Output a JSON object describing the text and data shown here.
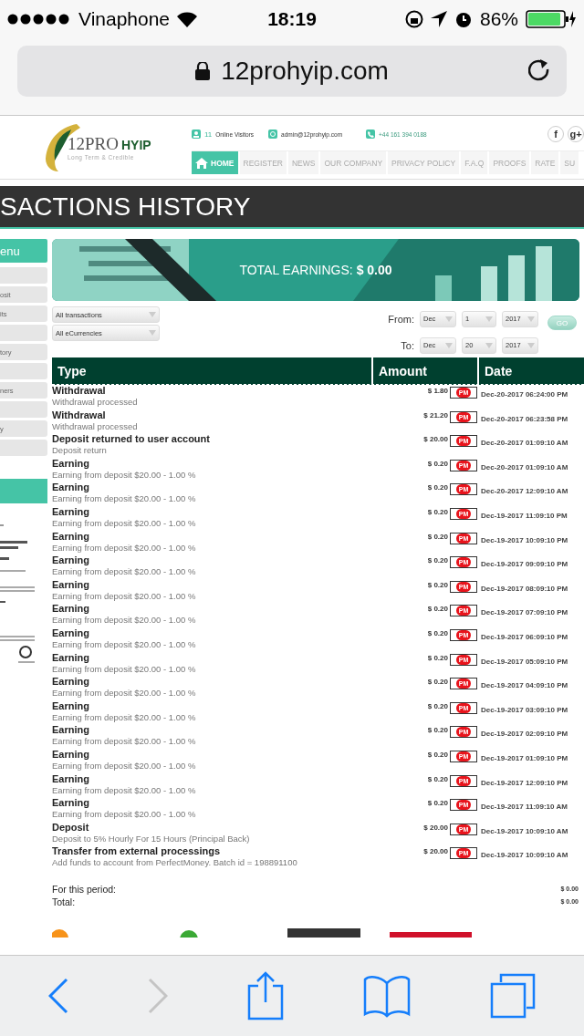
{
  "status_bar": {
    "carrier": "Vinaphone",
    "time": "18:19",
    "battery": "86%"
  },
  "address_bar": {
    "url": "12prohyip.com"
  },
  "header": {
    "logo_main": "12PRO",
    "logo_accent": "HYIP",
    "tagline": "Long Term & Credible",
    "visitors_count": "11",
    "visitors_label": "Online Visitors",
    "email": "admin@12prohyip.com",
    "phone": "+44 161 394 0188",
    "social": [
      "f",
      "g+"
    ]
  },
  "nav": [
    {
      "label": "HOME",
      "selected": true
    },
    {
      "label": "REGISTER",
      "selected": false
    },
    {
      "label": "NEWS",
      "selected": false
    },
    {
      "label": "OUR COMPANY",
      "selected": false
    },
    {
      "label": "PRIVACY POLICY",
      "selected": false
    },
    {
      "label": "F.A.Q",
      "selected": false
    },
    {
      "label": "PROOFS",
      "selected": false
    },
    {
      "label": "RATE",
      "selected": false
    },
    {
      "label": "SU",
      "selected": false
    }
  ],
  "page_title": "SACTIONS HISTORY",
  "sidebar": {
    "title": "enu",
    "items": [
      {
        "kind": "blank"
      },
      {
        "kind": "text",
        "label": "osit"
      },
      {
        "kind": "text",
        "label": "its"
      },
      {
        "kind": "blank"
      },
      {
        "kind": "text",
        "label": "tory"
      },
      {
        "kind": "blank"
      },
      {
        "kind": "text",
        "label": "ners"
      },
      {
        "kind": "blank"
      },
      {
        "kind": "text",
        "label": "y"
      },
      {
        "kind": "blank"
      }
    ]
  },
  "banner": {
    "label": "TOTAL EARNINGS:",
    "value": "$ 0.00"
  },
  "filters": {
    "transaction_type": "All transactions",
    "currency": "All eCurrencies",
    "from": {
      "label": "From:",
      "month": "Dec",
      "day": "1",
      "year": "2017"
    },
    "to": {
      "label": "To:",
      "month": "Dec",
      "day": "20",
      "year": "2017"
    },
    "go": "GO"
  },
  "table": {
    "columns": [
      "Type",
      "Amount",
      "Date"
    ],
    "rows": [
      {
        "type": "Withdrawal",
        "description": "Withdrawal processed",
        "amount": "$ 1.80",
        "processor": "PM",
        "date": "Dec-20-2017 06:24:00 PM"
      },
      {
        "type": "Withdrawal",
        "description": "Withdrawal processed",
        "amount": "$ 21.20",
        "processor": "PM",
        "date": "Dec-20-2017 06:23:58 PM"
      },
      {
        "type": "Deposit returned to user account",
        "description": "Deposit return",
        "amount": "$ 20.00",
        "processor": "PM",
        "date": "Dec-20-2017 01:09:10 AM"
      },
      {
        "type": "Earning",
        "description": "Earning from deposit $20.00 - 1.00 %",
        "amount": "$ 0.20",
        "processor": "PM",
        "date": "Dec-20-2017 01:09:10 AM"
      },
      {
        "type": "Earning",
        "description": "Earning from deposit $20.00 - 1.00 %",
        "amount": "$ 0.20",
        "processor": "PM",
        "date": "Dec-20-2017 12:09:10 AM"
      },
      {
        "type": "Earning",
        "description": "Earning from deposit $20.00 - 1.00 %",
        "amount": "$ 0.20",
        "processor": "PM",
        "date": "Dec-19-2017 11:09:10 PM"
      },
      {
        "type": "Earning",
        "description": "Earning from deposit $20.00 - 1.00 %",
        "amount": "$ 0.20",
        "processor": "PM",
        "date": "Dec-19-2017 10:09:10 PM"
      },
      {
        "type": "Earning",
        "description": "Earning from deposit $20.00 - 1.00 %",
        "amount": "$ 0.20",
        "processor": "PM",
        "date": "Dec-19-2017 09:09:10 PM"
      },
      {
        "type": "Earning",
        "description": "Earning from deposit $20.00 - 1.00 %",
        "amount": "$ 0.20",
        "processor": "PM",
        "date": "Dec-19-2017 08:09:10 PM"
      },
      {
        "type": "Earning",
        "description": "Earning from deposit $20.00 - 1.00 %",
        "amount": "$ 0.20",
        "processor": "PM",
        "date": "Dec-19-2017 07:09:10 PM"
      },
      {
        "type": "Earning",
        "description": "Earning from deposit $20.00 - 1.00 %",
        "amount": "$ 0.20",
        "processor": "PM",
        "date": "Dec-19-2017 06:09:10 PM"
      },
      {
        "type": "Earning",
        "description": "Earning from deposit $20.00 - 1.00 %",
        "amount": "$ 0.20",
        "processor": "PM",
        "date": "Dec-19-2017 05:09:10 PM"
      },
      {
        "type": "Earning",
        "description": "Earning from deposit $20.00 - 1.00 %",
        "amount": "$ 0.20",
        "processor": "PM",
        "date": "Dec-19-2017 04:09:10 PM"
      },
      {
        "type": "Earning",
        "description": "Earning from deposit $20.00 - 1.00 %",
        "amount": "$ 0.20",
        "processor": "PM",
        "date": "Dec-19-2017 03:09:10 PM"
      },
      {
        "type": "Earning",
        "description": "Earning from deposit $20.00 - 1.00 %",
        "amount": "$ 0.20",
        "processor": "PM",
        "date": "Dec-19-2017 02:09:10 PM"
      },
      {
        "type": "Earning",
        "description": "Earning from deposit $20.00 - 1.00 %",
        "amount": "$ 0.20",
        "processor": "PM",
        "date": "Dec-19-2017 01:09:10 PM"
      },
      {
        "type": "Earning",
        "description": "Earning from deposit $20.00 - 1.00 %",
        "amount": "$ 0.20",
        "processor": "PM",
        "date": "Dec-19-2017 12:09:10 PM"
      },
      {
        "type": "Earning",
        "description": "Earning from deposit $20.00 - 1.00 %",
        "amount": "$ 0.20",
        "processor": "PM",
        "date": "Dec-19-2017 11:09:10 AM"
      },
      {
        "type": "Deposit",
        "description": "Deposit to 5% Hourly For 15 Hours (Principal Back)",
        "amount": "$ 20.00",
        "processor": "PM",
        "date": "Dec-19-2017 10:09:10 AM"
      },
      {
        "type": "Transfer from external processings",
        "description": "Add funds to account from PerfectMoney. Batch id = 198891100",
        "amount": "$ 20.00",
        "processor": "PM",
        "date": "Dec-19-2017 10:09:10 AM"
      }
    ]
  },
  "totals": [
    {
      "label": "For this period:",
      "value": "$ 0.00"
    },
    {
      "label": "Total:",
      "value": "$ 0.00"
    }
  ],
  "toolbar": {
    "back_enabled": true,
    "forward_enabled": false
  }
}
